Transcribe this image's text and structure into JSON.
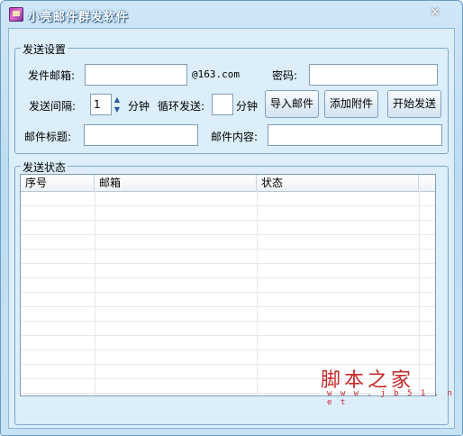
{
  "window": {
    "title": "小亮邮件群发软件",
    "close_glyph": "✕"
  },
  "send_settings": {
    "group_title": "发送设置",
    "sender_email_label": "发件邮箱:",
    "sender_email_value": "",
    "domain_suffix": "@163.com",
    "password_label": "密码:",
    "password_value": "",
    "interval_label": "发送间隔:",
    "interval_value": "1",
    "interval_unit": "分钟",
    "loop_label": "循环发送:",
    "loop_value": "",
    "loop_unit": "分钟",
    "import_button": "导入邮件",
    "attach_button": "添加附件",
    "start_button": "开始发送",
    "subject_label": "邮件标题:",
    "subject_value": "",
    "content_label": "邮件内容:",
    "content_value": ""
  },
  "send_status": {
    "group_title": "发送状态",
    "columns": [
      "序号",
      "邮箱",
      "状态"
    ]
  },
  "watermark": {
    "logo_text": "脚本之家",
    "url_text": "w w w . j b 5 1 . n e t"
  }
}
